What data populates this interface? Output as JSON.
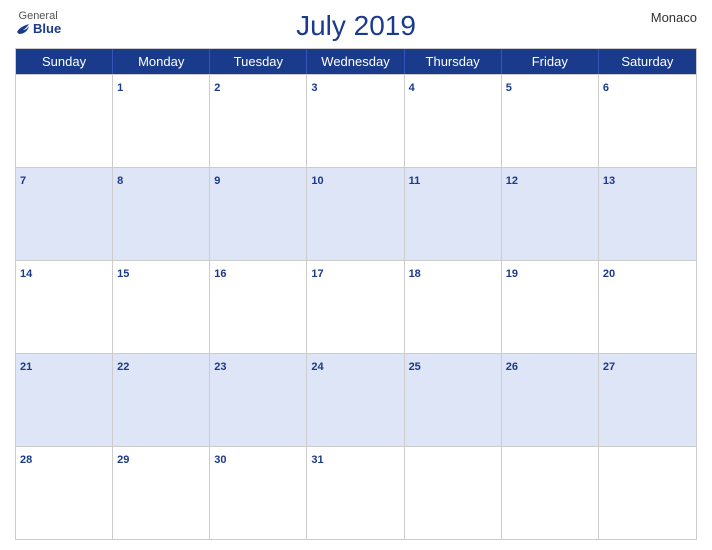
{
  "header": {
    "logo_general": "General",
    "logo_blue": "Blue",
    "title": "July 2019",
    "country": "Monaco"
  },
  "calendar": {
    "weekdays": [
      "Sunday",
      "Monday",
      "Tuesday",
      "Wednesday",
      "Thursday",
      "Friday",
      "Saturday"
    ],
    "weeks": [
      [
        {
          "day": "",
          "blue": false
        },
        {
          "day": "1",
          "blue": false
        },
        {
          "day": "2",
          "blue": false
        },
        {
          "day": "3",
          "blue": false
        },
        {
          "day": "4",
          "blue": false
        },
        {
          "day": "5",
          "blue": false
        },
        {
          "day": "6",
          "blue": false
        }
      ],
      [
        {
          "day": "7",
          "blue": true
        },
        {
          "day": "8",
          "blue": true
        },
        {
          "day": "9",
          "blue": true
        },
        {
          "day": "10",
          "blue": true
        },
        {
          "day": "11",
          "blue": true
        },
        {
          "day": "12",
          "blue": true
        },
        {
          "day": "13",
          "blue": true
        }
      ],
      [
        {
          "day": "14",
          "blue": false
        },
        {
          "day": "15",
          "blue": false
        },
        {
          "day": "16",
          "blue": false
        },
        {
          "day": "17",
          "blue": false
        },
        {
          "day": "18",
          "blue": false
        },
        {
          "day": "19",
          "blue": false
        },
        {
          "day": "20",
          "blue": false
        }
      ],
      [
        {
          "day": "21",
          "blue": true
        },
        {
          "day": "22",
          "blue": true
        },
        {
          "day": "23",
          "blue": true
        },
        {
          "day": "24",
          "blue": true
        },
        {
          "day": "25",
          "blue": true
        },
        {
          "day": "26",
          "blue": true
        },
        {
          "day": "27",
          "blue": true
        }
      ],
      [
        {
          "day": "28",
          "blue": false
        },
        {
          "day": "29",
          "blue": false
        },
        {
          "day": "30",
          "blue": false
        },
        {
          "day": "31",
          "blue": false
        },
        {
          "day": "",
          "blue": false
        },
        {
          "day": "",
          "blue": false
        },
        {
          "day": "",
          "blue": false
        }
      ]
    ]
  }
}
